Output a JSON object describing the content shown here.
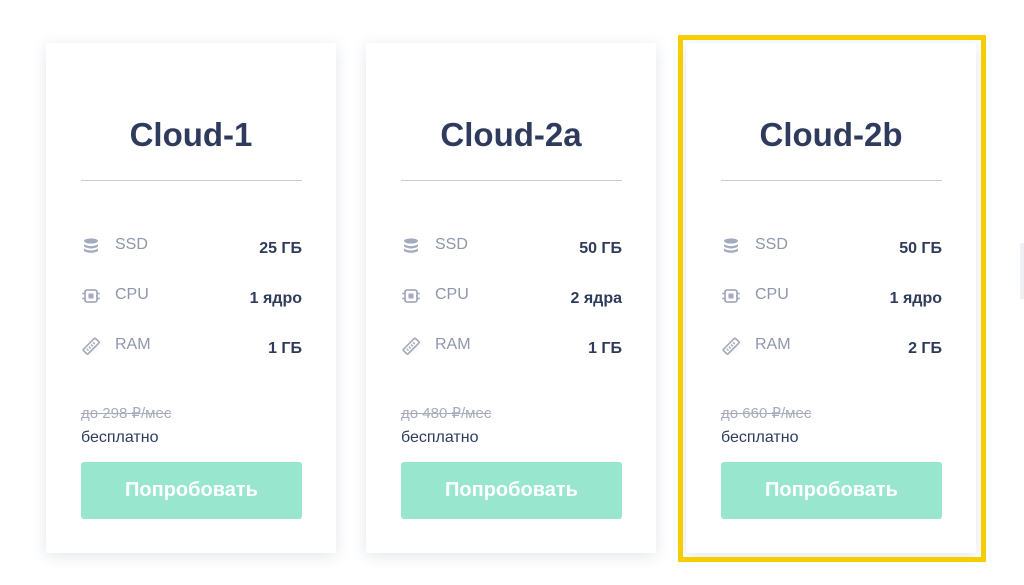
{
  "colors": {
    "title": "#2f3b5c",
    "muted": "#8e96aa",
    "button": "#98e6cd",
    "highlight_border": "#f6cd00"
  },
  "plans": [
    {
      "name": "Cloud-1",
      "specs": [
        {
          "icon": "database-icon",
          "label": "SSD",
          "value": "25 ГБ"
        },
        {
          "icon": "cpu-chip-icon",
          "label": "CPU",
          "value": "1 ядро"
        },
        {
          "icon": "ram-stick-icon",
          "label": "RAM",
          "value": "1 ГБ"
        }
      ],
      "old_price": "до 298 ₽/мес",
      "price": "бесплатно",
      "button": "Попробовать"
    },
    {
      "name": "Cloud-2a",
      "specs": [
        {
          "icon": "database-icon",
          "label": "SSD",
          "value": "50 ГБ"
        },
        {
          "icon": "cpu-chip-icon",
          "label": "CPU",
          "value": "2 ядра"
        },
        {
          "icon": "ram-stick-icon",
          "label": "RAM",
          "value": "1 ГБ"
        }
      ],
      "old_price": "до 480 ₽/мес",
      "price": "бесплатно",
      "button": "Попробовать"
    },
    {
      "name": "Cloud-2b",
      "specs": [
        {
          "icon": "database-icon",
          "label": "SSD",
          "value": "50 ГБ"
        },
        {
          "icon": "cpu-chip-icon",
          "label": "CPU",
          "value": "1 ядро"
        },
        {
          "icon": "ram-stick-icon",
          "label": "RAM",
          "value": "2 ГБ"
        }
      ],
      "old_price": "до 660 ₽/мес",
      "price": "бесплатно",
      "button": "Попробовать",
      "highlighted": true
    }
  ]
}
